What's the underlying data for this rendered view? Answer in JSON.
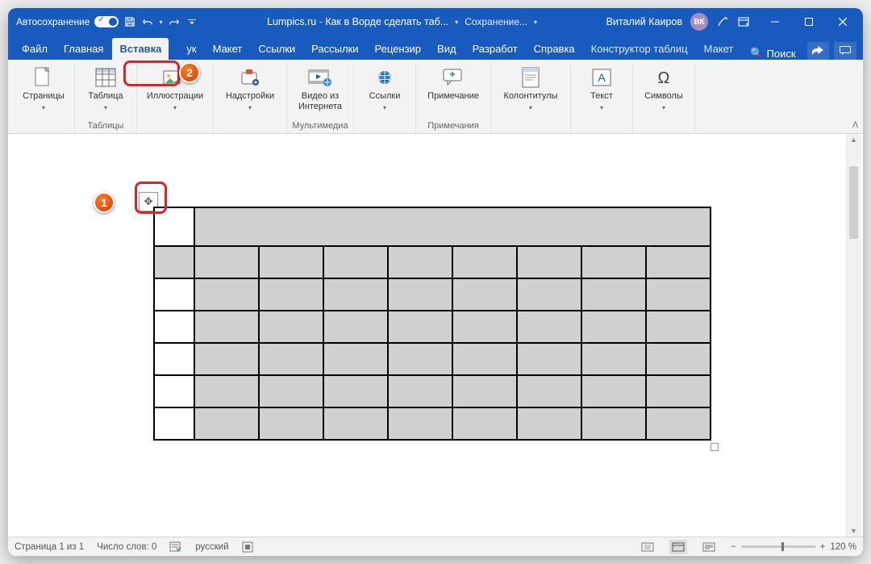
{
  "titlebar": {
    "autosave": "Автосохранение",
    "doc_title": "Lumpics.ru - Как в Ворде сделать таб...",
    "saving": "Сохранение...",
    "user": "Виталий Каиров",
    "initials": "ВК"
  },
  "tabs": {
    "file": "Файл",
    "home": "Главная",
    "insert": "Вставка",
    "draw_cut": "ук",
    "layout": "Макет",
    "references": "Ссылки",
    "mailings": "Рассылки",
    "review": "Рецензир",
    "view": "Вид",
    "developer": "Разработ",
    "help": "Справка",
    "table_design": "Конструктор таблиц",
    "table_layout": "Макет",
    "search": "Поиск"
  },
  "ribbon": {
    "pages": {
      "btn": "Страницы"
    },
    "tables": {
      "btn": "Таблица",
      "group": "Таблицы"
    },
    "illustrations": {
      "btn": "Иллюстрации"
    },
    "addins": {
      "btn": "Надстройки"
    },
    "media": {
      "btn": "Видео из\nИнтернета",
      "group": "Мультимедиа"
    },
    "links": {
      "btn": "Ссылки"
    },
    "comments": {
      "btn": "Примечание",
      "group": "Примечания"
    },
    "headers": {
      "btn": "Колонтитулы"
    },
    "text": {
      "btn": "Текст"
    },
    "symbols": {
      "btn": "Символы"
    }
  },
  "status": {
    "page": "Страница 1 из 1",
    "words": "Число слов: 0",
    "lang": "русский",
    "zoom": "120 %"
  },
  "callouts": {
    "one": "1",
    "two": "2"
  }
}
